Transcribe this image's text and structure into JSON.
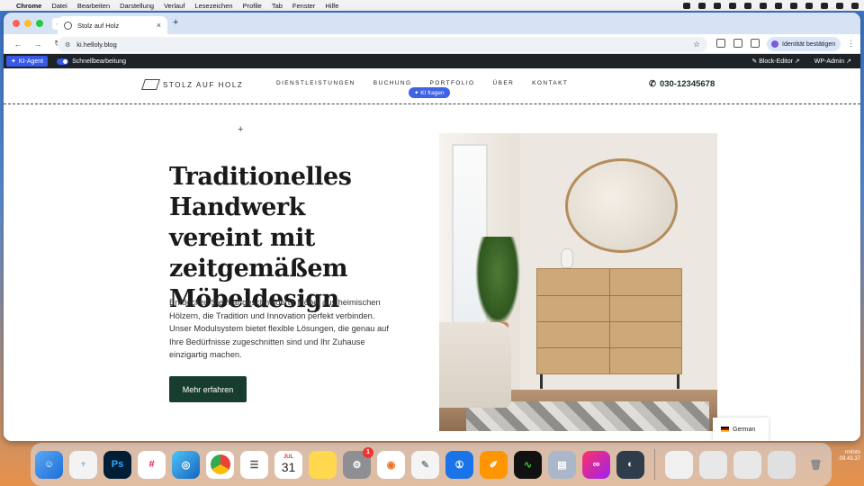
{
  "menubar": {
    "app": "Chrome",
    "items": [
      "Datei",
      "Bearbeiten",
      "Darstellung",
      "Verlauf",
      "Lesezeichen",
      "Profile",
      "Tab",
      "Fenster",
      "Hilfe"
    ]
  },
  "browser": {
    "tab_title": "Stolz auf Holz",
    "url": "ki.helloly.blog",
    "identity_label": "Identität bestätigen"
  },
  "wpbar": {
    "ki_agent": "KI-Agent",
    "schnell": "Schnellbearbeitung",
    "block_editor": "Block-Editor",
    "wp_admin": "WP-Admin"
  },
  "site": {
    "logo": "STOLZ AUF HOLZ",
    "nav": [
      "DIENSTLEISTUNGEN",
      "BUCHUNG",
      "PORTFOLIO",
      "ÜBER",
      "KONTAKT"
    ],
    "ki_fragen": "KI fragen",
    "phone": "030-12345678"
  },
  "hero": {
    "headline": "Traditionelles Handwerk vereint mit zeitgemäßem Möbeldesign",
    "paragraph": "Entdecken Sie maßgeschneiderte Möbel aus heimischen Hölzern, die Tradition und Innovation perfekt verbinden. Unser Modulsystem bietet flexible Lösungen, die genau auf Ihre Bedürfnisse zugeschnitten sind und Ihr Zuhause einzigartig machen.",
    "cta": "Mehr erfahren"
  },
  "language": "German",
  "dock": {
    "calendar_month": "JUL",
    "calendar_day": "31",
    "settings_badge": "1"
  },
  "desktop": {
    "label1": "rmfoto",
    "label2": ".09.43.37"
  },
  "colors": {
    "accent_green": "#173d2f",
    "wp_blue": "#3858e9"
  }
}
